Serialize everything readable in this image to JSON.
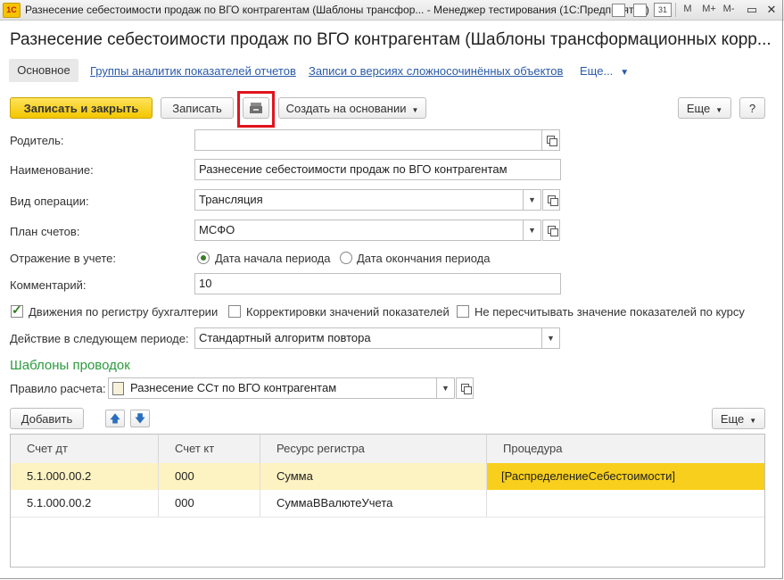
{
  "window": {
    "title": "Разнесение себестоимости продаж по ВГО контрагентам (Шаблоны трансфор... - Менеджер тестирования (1С:Предприятие)",
    "app_icon": "1С",
    "toolbar_right": [
      "M",
      "M+",
      "M-"
    ],
    "calendar_day": "31"
  },
  "header": {
    "title": "Разнесение себестоимости продаж по ВГО контрагентам (Шаблоны трансформационных корр...",
    "tabs": [
      {
        "label": "Основное",
        "active": true
      },
      {
        "label": "Группы аналитик показателей отчетов"
      },
      {
        "label": "Записи о версиях сложносочинённых объектов"
      },
      {
        "label": "Еще..."
      }
    ]
  },
  "command_bar": {
    "save_close": "Записать и закрыть",
    "save": "Записать",
    "create_based": "Создать на основании",
    "more": "Еще",
    "help": "?"
  },
  "form": {
    "parent_label": "Родитель:",
    "parent_value": "",
    "name_label": "Наименование:",
    "name_value": "Разнесение себестоимости продаж по ВГО контрагентам",
    "operation_label": "Вид операции:",
    "operation_value": "Трансляция",
    "chart_label": "План счетов:",
    "chart_value": "МСФО",
    "reflection_label": "Отражение в учете:",
    "reflection_option1": "Дата начала периода",
    "reflection_option2": "Дата окончания периода",
    "comment_label": "Комментарий:",
    "comment_value": "10",
    "check1": "Движения по регистру бухгалтерии",
    "check2": "Корректировки значений показателей",
    "check3": "Не пересчитывать значение показателей по курсу",
    "next_period_label": "Действие в следующем периоде:",
    "next_period_value": "Стандартный алгоритм повтора"
  },
  "templates": {
    "section_title": "Шаблоны проводок",
    "rule_label": "Правило расчета:",
    "rule_value": "Разнесение ССт по ВГО контрагентам",
    "add_button": "Добавить",
    "more": "Еще",
    "columns": [
      "Счет дт",
      "Счет кт",
      "Ресурс регистра",
      "Процедура"
    ],
    "rows": [
      [
        "5.1.000.00.2",
        "000",
        "Сумма",
        "[РаспределениеСебестоимости]"
      ],
      [
        "5.1.000.00.2",
        "000",
        "СуммаВВалютеУчета",
        ""
      ]
    ]
  },
  "colors": {
    "accent_yellow": "#f3c600",
    "selected_row": "#fdf2c2",
    "highlight_cell": "#f8cf1c",
    "section_green": "#2c9a3e",
    "link_blue": "#2a5aa8",
    "annotation_red": "#e0141e"
  },
  "icons": {
    "post_icon": "printer-archive-icon"
  }
}
